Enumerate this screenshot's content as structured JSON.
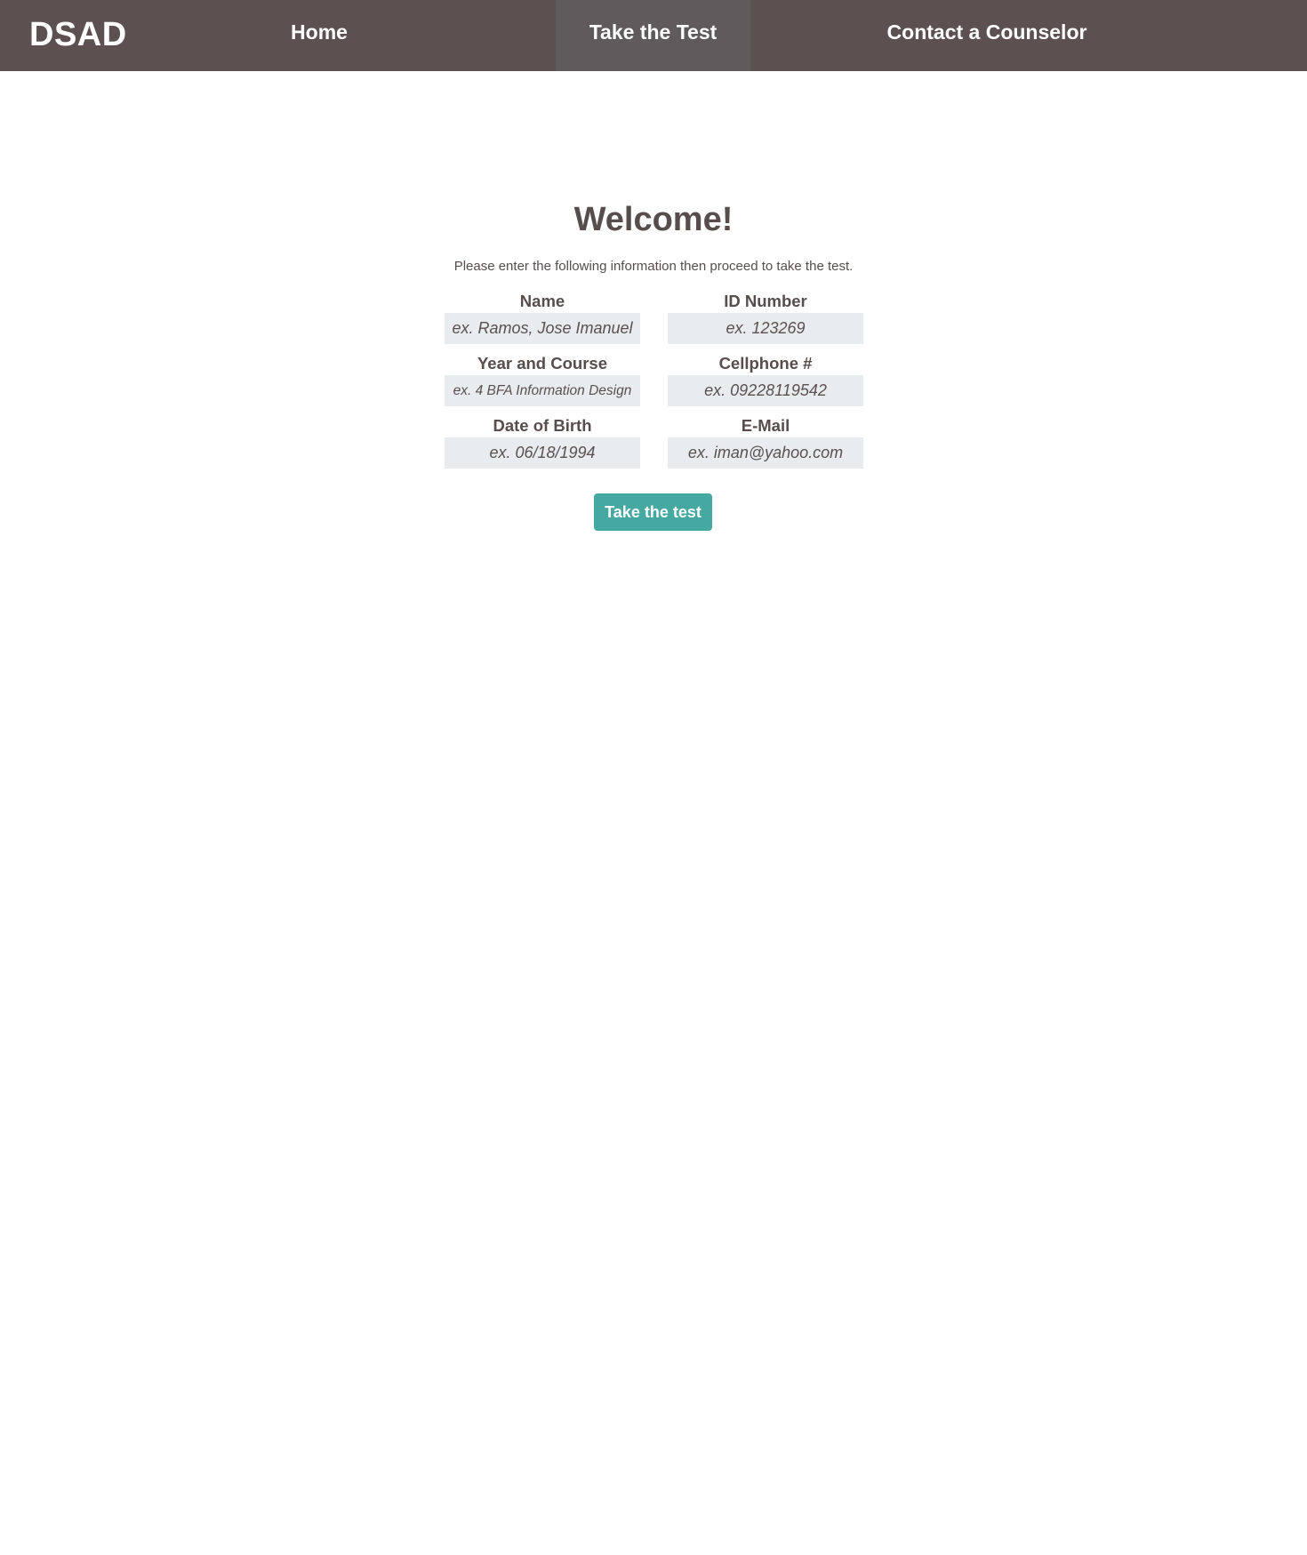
{
  "nav": {
    "brand": "DSAD",
    "items": [
      {
        "label": "Home"
      },
      {
        "label": "Take the Test",
        "active": true
      },
      {
        "label": "Contact a Counselor"
      }
    ]
  },
  "main": {
    "title": "Welcome!",
    "intro": "Please enter the following information then proceed to take the test.",
    "fields": {
      "name": {
        "label": "Name",
        "value": "",
        "placeholder": "ex. Ramos, Jose Imanuel"
      },
      "id_number": {
        "label": "ID Number",
        "value": "",
        "placeholder": "ex. 123269"
      },
      "year_course": {
        "label": "Year and Course",
        "value": "",
        "placeholder": "ex. 4 BFA Information Design"
      },
      "cellphone": {
        "label": "Cellphone #",
        "value": "",
        "placeholder": "ex. 09228119542"
      },
      "dob": {
        "label": "Date of Birth",
        "value": "",
        "placeholder": "ex. 06/18/1994"
      },
      "email": {
        "label": "E-Mail",
        "value": "",
        "placeholder": "ex. iman@yahoo.com"
      }
    },
    "submit_label": "Take the test"
  },
  "colors": {
    "navbar_bg": "#5c5150",
    "nav_active_bg": "#5f5b5c",
    "text": "#574d4d",
    "input_bg": "#e9ecee",
    "button_bg": "#45a9a2"
  }
}
